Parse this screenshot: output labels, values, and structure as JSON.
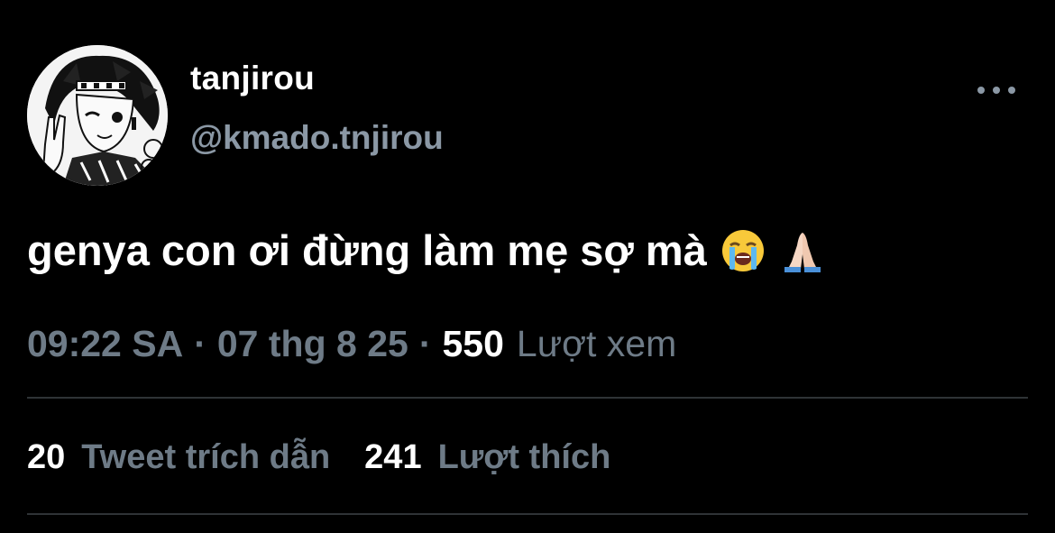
{
  "user": {
    "display_name": "tanjirou",
    "handle": "@kmado.tnjirou",
    "avatar_icon": "anime-avatar"
  },
  "more_icon": "more-horizontal-icon",
  "tweet": {
    "text": "genya con ơi đừng làm mẹ sợ mà",
    "emojis": [
      "loudly-crying-face-emoji",
      "folded-hands-emoji"
    ]
  },
  "meta": {
    "time": "09:22 SA",
    "separator": "·",
    "date": "07 thg 8 25",
    "views_count": "550",
    "views_label": "Lượt xem"
  },
  "stats": {
    "quotes_count": "20",
    "quotes_label": "Tweet trích dẫn",
    "likes_count": "241",
    "likes_label": "Lượt thích"
  },
  "colors": {
    "background": "#000000",
    "primary_text": "#ffffff",
    "secondary_text": "#6e7b87",
    "divider": "#2f3336"
  }
}
